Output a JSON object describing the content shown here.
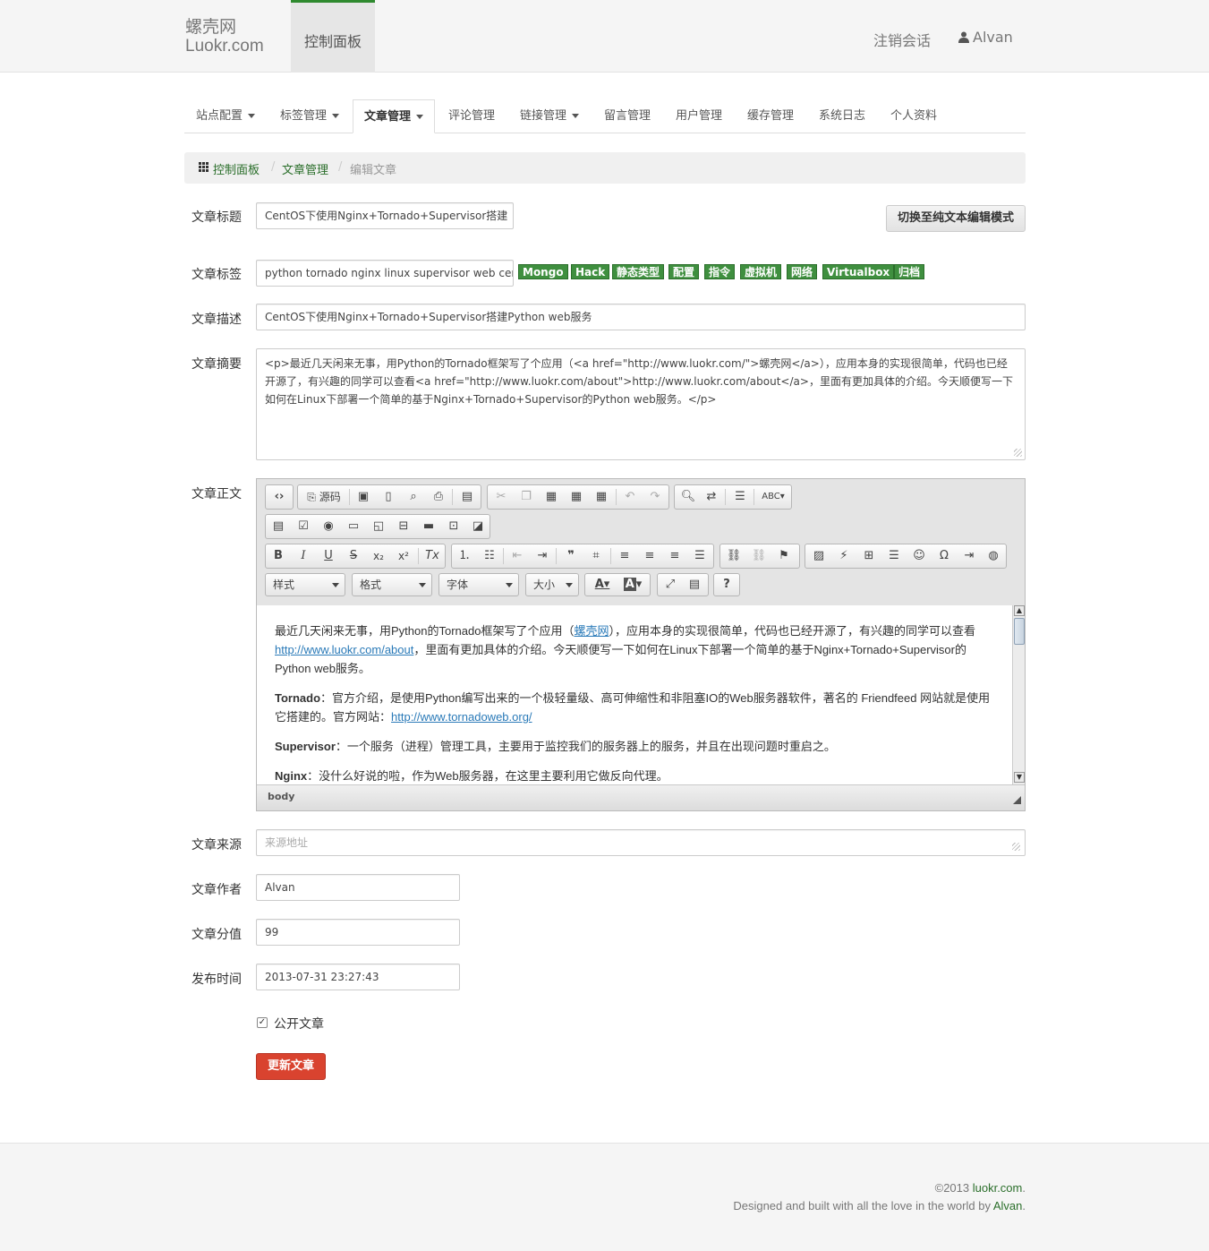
{
  "header": {
    "brand_line1": "螺壳网",
    "brand_line2": "Luokr.com",
    "active_nav": "控制面板",
    "logout": "注销会话",
    "user": "Alvan"
  },
  "tabs": [
    "站点配置",
    "标签管理",
    "文章管理",
    "评论管理",
    "链接管理",
    "留言管理",
    "用户管理",
    "缓存管理",
    "系统日志",
    "个人资料"
  ],
  "breadcrumb": [
    "控制面板",
    "文章管理",
    "编辑文章"
  ],
  "form": {
    "title_label": "文章标题",
    "title_value": "CentOS下使用Nginx+Tornado+Supervisor搭建",
    "switch_button": "切换至纯文本编辑模式",
    "tags_label": "文章标签",
    "tags_value": "python tornado nginx linux supervisor web cen",
    "tag_suggestions": [
      "Mongo",
      "Hack",
      "静态类型",
      "配置",
      "指令",
      "虚拟机",
      "网络",
      "Virtualbox",
      "归档"
    ],
    "desc_label": "文章描述",
    "desc_value": "CentOS下使用Nginx+Tornado+Supervisor搭建Python web服务",
    "summary_label": "文章摘要",
    "summary_value": "<p>最近几天闲来无事，用Python的Tornado框架写了个应用（<a href=\"http://www.luokr.com/\">螺壳网</a>），应用本身的实现很简单，代码也已经开源了，有兴趣的同学可以查看<a href=\"http://www.luokr.com/about\">http://www.luokr.com/about</a>，里面有更加具体的介绍。今天顺便写一下如何在Linux下部署一个简单的基于Nginx+Tornado+Supervisor的Python web服务。</p>",
    "body_label": "文章正文",
    "source_label": "文章来源",
    "source_placeholder": "来源地址",
    "author_label": "文章作者",
    "author_value": "Alvan",
    "score_label": "文章分值",
    "score_value": "99",
    "time_label": "发布时间",
    "time_value": "2013-07-31 23:27:43",
    "public_label": "公开文章",
    "submit": "更新文章"
  },
  "editor": {
    "source_button": "源码",
    "combos": [
      "样式",
      "格式",
      "字体",
      "大小"
    ],
    "status_path": "body",
    "p1_a": "最近几天闲来无事，用Python的Tornado框架写了个应用（",
    "p1_link1": "螺壳网",
    "p1_b": "），应用本身的实现很简单，代码也已经开源了，有兴趣的同学可以查看",
    "p1_link2": "http://www.luokr.com/about",
    "p1_c": "，里面有更加具体的介绍。今天顺便写一下如何在Linux下部署一个简单的基于Nginx+Tornado+Supervisor的Python web服务。",
    "p2_bold": "Tornado",
    "p2_text": "：官方介绍，是使用Python编写出来的一个极轻量级、高可伸缩性和非阻塞IO的Web服务器软件，著名的 Friendfeed 网站就是使用它搭建的。官方网站：",
    "p2_link": "http://www.tornadoweb.org/",
    "p3_bold": "Supervisor",
    "p3_text": "：一个服务（进程）管理工具，主要用于监控我们的服务器上的服务，并且在出现问题时重启之。",
    "p4_bold": "Nginx",
    "p4_text": "：没什么好说的啦，作为Web服务器，在这里主要利用它做反向代理。"
  },
  "footer": {
    "copy_prefix": "©2013 ",
    "copy_link": "luokr.com",
    "copy_suffix": ".",
    "built_prefix": "Designed and built with all the love in the world by ",
    "built_link": "Alvan",
    "built_suffix": "."
  }
}
